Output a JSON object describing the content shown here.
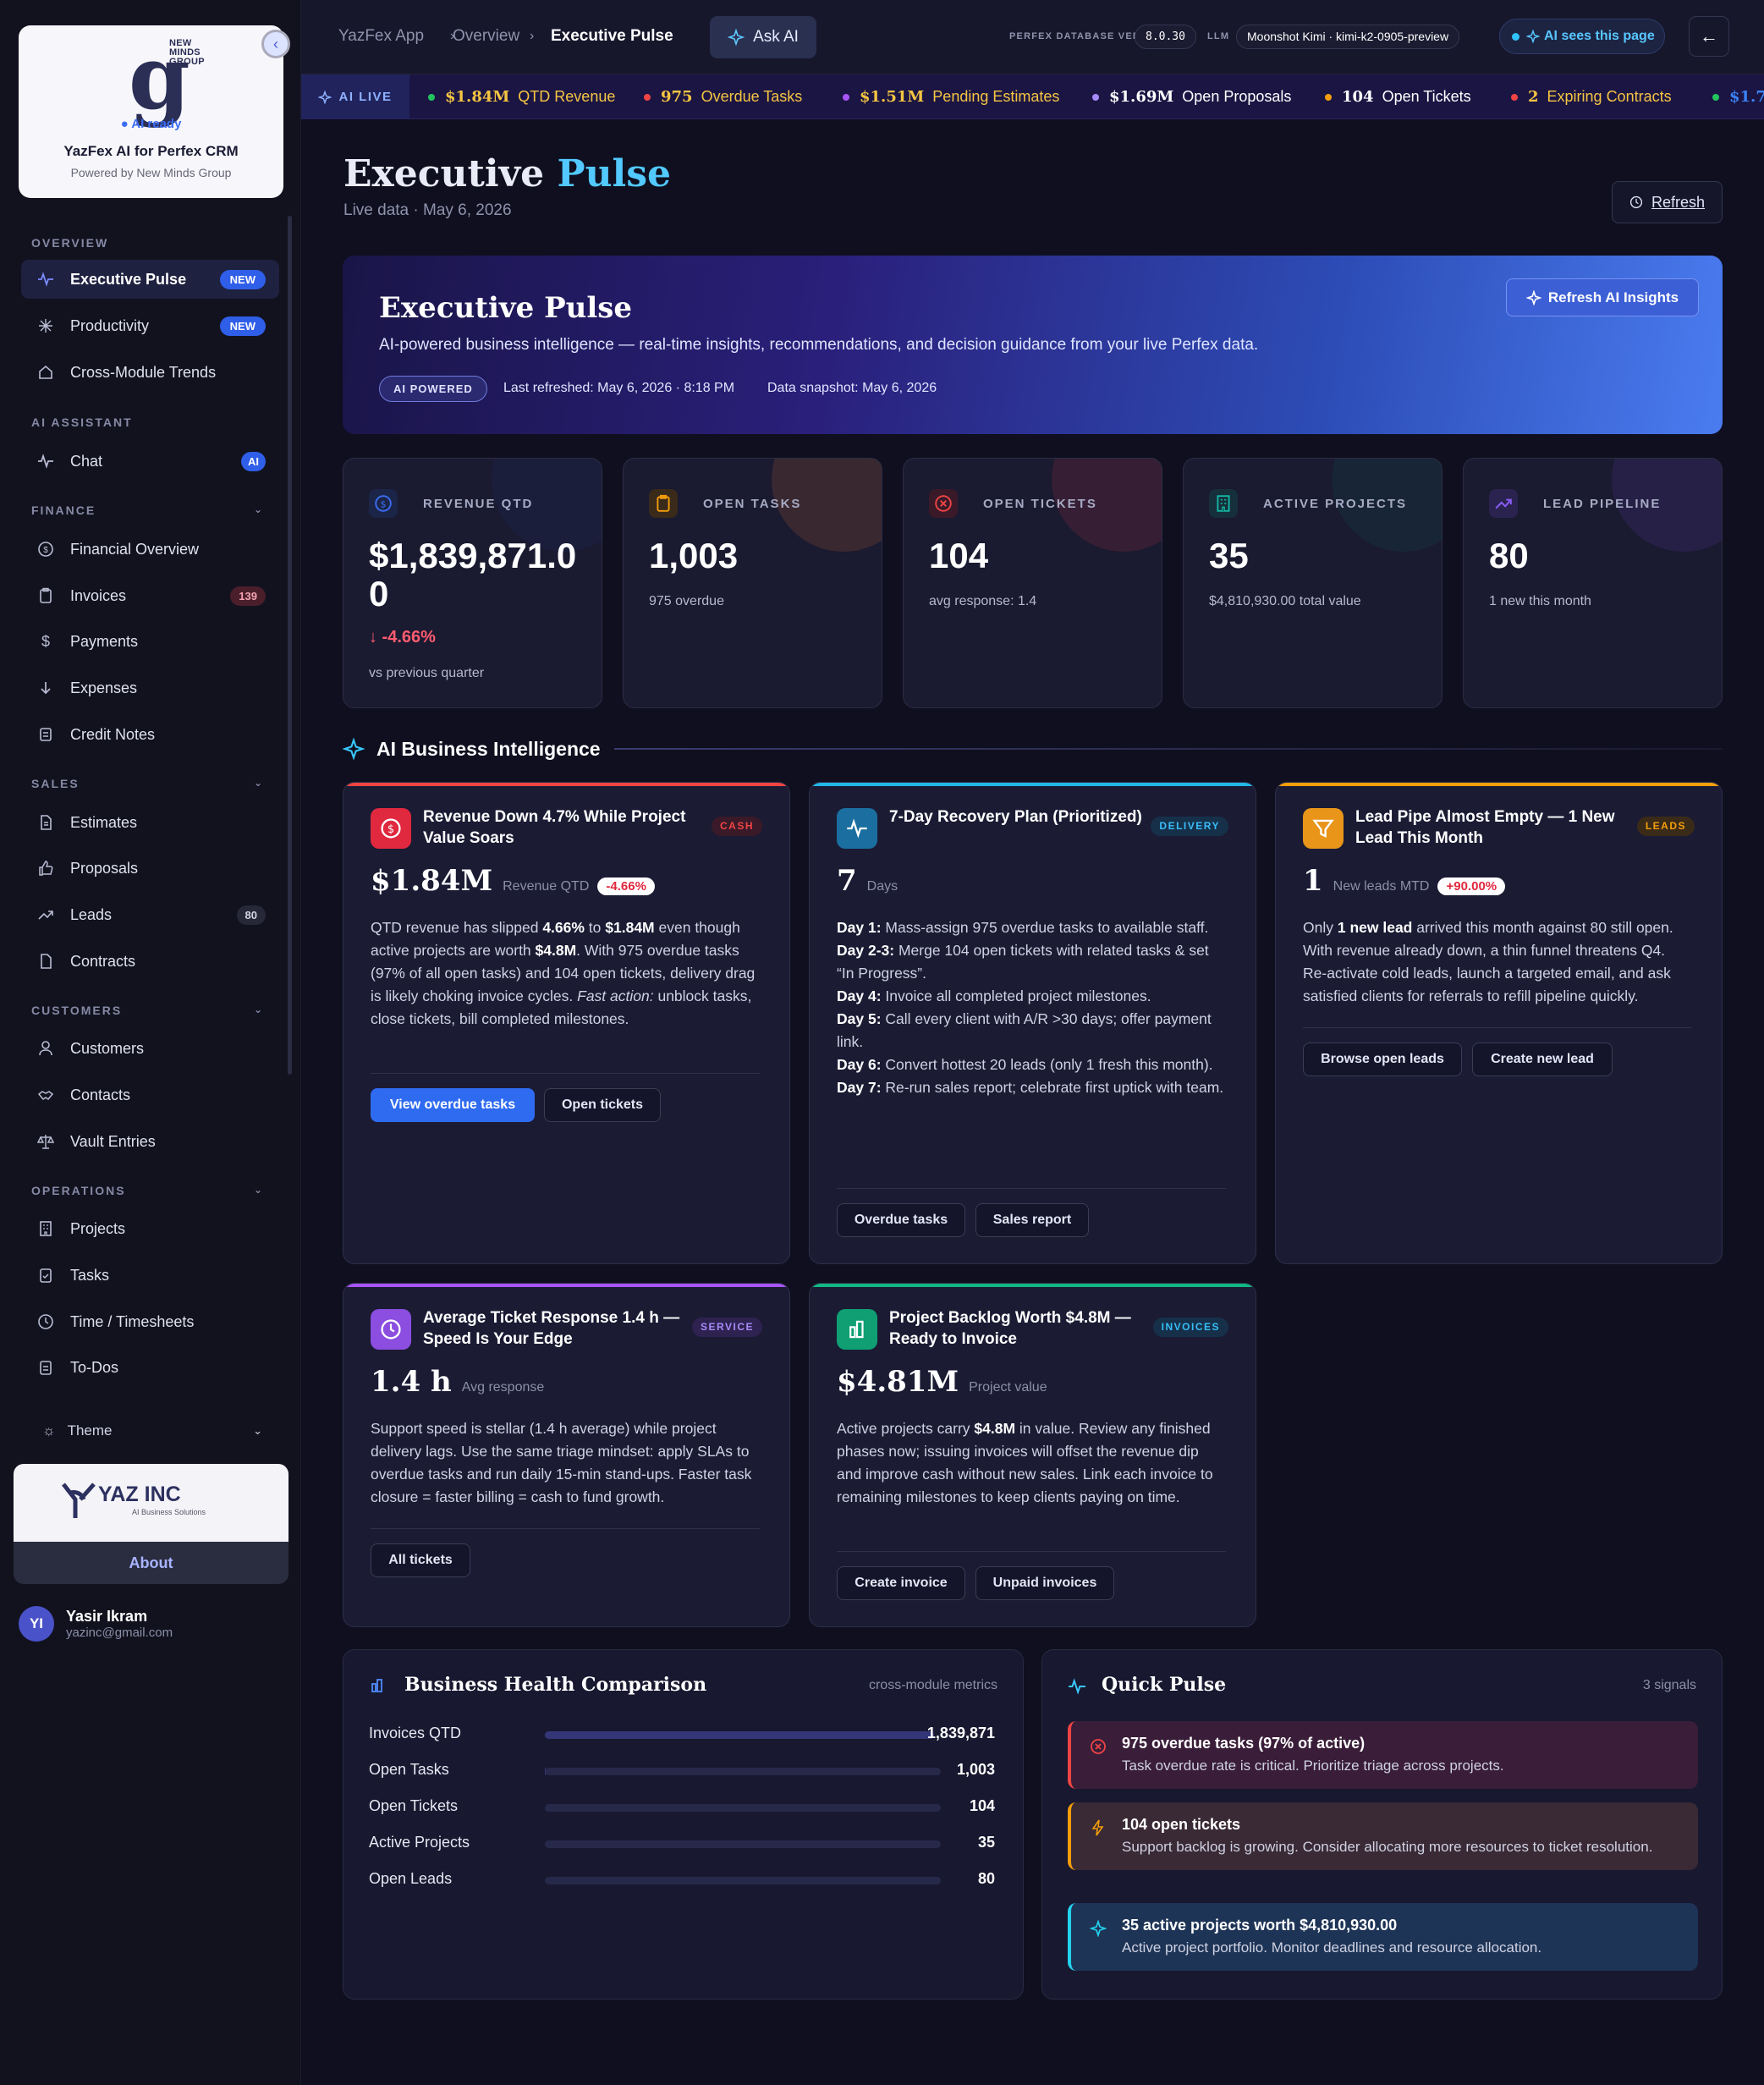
{
  "brand": {
    "logo_letter": "g",
    "logo_company": "NEW MINDS GROUP",
    "status": "AI ready",
    "title": "YazFex AI for Perfex CRM",
    "powered": "Powered by New Minds Group"
  },
  "sidebar": {
    "sections": {
      "overview": "OVERVIEW",
      "ai": "AI ASSISTANT",
      "finance": "FINANCE",
      "sales": "SALES",
      "customers": "CUSTOMERS",
      "operations": "OPERATIONS"
    },
    "items": {
      "executive_pulse": {
        "label": "Executive Pulse",
        "badge": "NEW"
      },
      "productivity": {
        "label": "Productivity",
        "badge": "NEW"
      },
      "cross_module": {
        "label": "Cross-Module Trends"
      },
      "chat": {
        "label": "Chat",
        "badge": "AI"
      },
      "financial_overview": {
        "label": "Financial Overview"
      },
      "invoices": {
        "label": "Invoices",
        "badge": "139"
      },
      "payments": {
        "label": "Payments"
      },
      "expenses": {
        "label": "Expenses"
      },
      "credit_notes": {
        "label": "Credit Notes"
      },
      "estimates": {
        "label": "Estimates"
      },
      "proposals": {
        "label": "Proposals"
      },
      "leads": {
        "label": "Leads",
        "badge": "80"
      },
      "contracts": {
        "label": "Contracts"
      },
      "customers": {
        "label": "Customers"
      },
      "contacts": {
        "label": "Contacts"
      },
      "vault": {
        "label": "Vault Entries"
      },
      "projects": {
        "label": "Projects"
      },
      "tasks": {
        "label": "Tasks"
      },
      "time": {
        "label": "Time / Timesheets"
      },
      "todos": {
        "label": "To-Dos"
      }
    },
    "theme_label": "Theme",
    "company": {
      "name": "YAZ INC",
      "tagline": "AI Business Solutions",
      "about": "About"
    },
    "user": {
      "initials": "YI",
      "name": "Yasir Ikram",
      "email": "yazinc@gmail.com"
    }
  },
  "topbar": {
    "crumbs": [
      "YazFex App",
      "Overview",
      "Executive Pulse"
    ],
    "ask_ai": "Ask AI",
    "db_label": "PERFEX DATABASE VER.",
    "db_version": "8.0.30",
    "llm_label": "LLM",
    "llm_model": "Moonshot Kimi · kimi-k2-0905-preview",
    "ai_sees": "AI sees this page",
    "back": "←"
  },
  "ticker": {
    "live_label": "AI LIVE",
    "items": [
      {
        "value": "$1.84M",
        "label": "QTD Revenue",
        "color": "#f5c542",
        "dot": "#22c55e"
      },
      {
        "value": "975",
        "label": "Overdue Tasks",
        "color": "#f5c542",
        "dot": "#ef4444"
      },
      {
        "value": "$1.51M",
        "label": "Pending Estimates",
        "color": "#f5c542",
        "dot": "#a855f7"
      },
      {
        "value": "$1.69M",
        "label": "Open Proposals",
        "color": "#ffffff",
        "dot": "#a78bfa"
      },
      {
        "value": "104",
        "label": "Open Tickets",
        "color": "#ffffff",
        "dot": "#f59e0b"
      },
      {
        "value": "2",
        "label": "Expiring Contracts",
        "color": "#f5c542",
        "dot": "#ef4444"
      },
      {
        "value": "$1.7",
        "label": "",
        "color": "#3b82f6",
        "dot": "#22c55e"
      }
    ]
  },
  "page": {
    "title_a": "Executive",
    "title_b": "Pulse",
    "subtitle": "Live data · May 6, 2026",
    "refresh": "Refresh"
  },
  "hero": {
    "title": "Executive Pulse",
    "description": "AI-powered business intelligence — real-time insights, recommendations, and decision guidance from your live Perfex data.",
    "tag": "AI POWERED",
    "last_refreshed": "Last refreshed: May 6, 2026 · 8:18 PM",
    "snapshot": "Data snapshot: May 6, 2026",
    "button": "Refresh AI Insights"
  },
  "kpis": [
    {
      "label": "REVENUE QTD",
      "value": "$1,839,871.00",
      "delta": "↓ -4.66%",
      "sub": "vs previous quarter",
      "color": "#3b6ef5"
    },
    {
      "label": "OPEN TASKS",
      "value": "1,003",
      "sub": "975 overdue",
      "color": "#f59e0b"
    },
    {
      "label": "OPEN TICKETS",
      "value": "104",
      "sub": "avg response: 1.4",
      "color": "#ef4444"
    },
    {
      "label": "ACTIVE PROJECTS",
      "value": "35",
      "sub": "$4,810,930.00 total value",
      "color": "#14b8a6"
    },
    {
      "label": "LEAD PIPELINE",
      "value": "80",
      "sub": "1 new this month",
      "color": "#8b5cf6"
    }
  ],
  "section_title": "AI Business Intelligence",
  "insights": {
    "revenue": {
      "title": "Revenue Down 4.7% While Project Value Soars",
      "tag": "CASH",
      "value": "$1.84M",
      "unit": "Revenue QTD",
      "change": "-4.66%",
      "p1": "QTD revenue has slipped ",
      "b1": "4.66%",
      "p2": " to ",
      "b2": "$1.84M",
      "p3": " even though active projects are worth ",
      "b3": "$4.8M",
      "p4": ". With 975 overdue tasks (97% of all open tasks) and 104 open tickets, delivery drag is likely choking invoice cycles. ",
      "i1": "Fast action:",
      "p5": " unblock tasks, close tickets, bill completed milestones.",
      "btn1": "View overdue tasks",
      "btn2": "Open tickets"
    },
    "recovery": {
      "title": "7-Day Recovery Plan (Prioritized)",
      "tag": "DELIVERY",
      "value": "7",
      "unit": "Days",
      "days": [
        {
          "d": "Day 1:",
          "t": " Mass-assign 975 overdue tasks to available staff."
        },
        {
          "d": "Day 2-3:",
          "t": " Merge 104 open tickets with related tasks & set “In Progress”."
        },
        {
          "d": "Day 4:",
          "t": " Invoice all completed project milestones."
        },
        {
          "d": "Day 5:",
          "t": " Call every client with A/R >30 days; offer payment link."
        },
        {
          "d": "Day 6:",
          "t": " Convert hottest 20 leads (only 1 fresh this month)."
        },
        {
          "d": "Day 7:",
          "t": " Re-run sales report; celebrate first uptick with team."
        }
      ],
      "btn1": "Overdue tasks",
      "btn2": "Sales report"
    },
    "leads": {
      "title": "Lead Pipe Almost Empty — 1 New Lead This Month",
      "tag": "LEADS",
      "value": "1",
      "unit": "New leads MTD",
      "change": "+90.00%",
      "p1": "Only ",
      "b1": "1 new lead",
      "p2": " arrived this month against 80 still open. With revenue already down, a thin funnel threatens Q4. Re-activate cold leads, launch a targeted email, and ask satisfied clients for referrals to refill pipeline quickly.",
      "btn1": "Browse open leads",
      "btn2": "Create new lead"
    },
    "tickets": {
      "title": "Average Ticket Response 1.4 h — Speed Is Your Edge",
      "tag": "SERVICE",
      "value": "1.4 h",
      "unit": "Avg response",
      "body": "Support speed is stellar (1.4 h average) while project delivery lags. Use the same triage mindset: apply SLAs to overdue tasks and run daily 15-min stand-ups. Faster task closure = faster billing = cash to fund growth.",
      "btn1": "All tickets"
    },
    "backlog": {
      "title": "Project Backlog Worth $4.8M — Ready to Invoice",
      "tag": "INVOICES",
      "value": "$4.81M",
      "unit": "Project value",
      "p1": "Active projects carry ",
      "b1": "$4.8M",
      "p2": " in value. Review any finished phases now; issuing invoices will offset the revenue dip and improve cash without new sales. Link each invoice to remaining milestones to keep clients paying on time.",
      "btn1": "Create invoice",
      "btn2": "Unpaid invoices"
    }
  },
  "health": {
    "title": "Business Health Comparison",
    "right": "cross-module metrics",
    "rows": [
      {
        "label": "Invoices QTD",
        "value": "1,839,871",
        "pct": 100
      },
      {
        "label": "Open Tasks",
        "value": "1,003",
        "pct": 0.05
      },
      {
        "label": "Open Tickets",
        "value": "104",
        "pct": 0.01
      },
      {
        "label": "Active Projects",
        "value": "35",
        "pct": 0
      },
      {
        "label": "Open Leads",
        "value": "80",
        "pct": 0
      }
    ]
  },
  "pulse": {
    "title": "Quick Pulse",
    "right": "3 signals",
    "signals": [
      {
        "title": "975 overdue tasks (97% of active)",
        "desc": "Task overdue rate is critical. Prioritize triage across projects.",
        "color": "#ef4444"
      },
      {
        "title": "104 open tickets",
        "desc": "Support backlog is growing. Consider allocating more resources to ticket resolution.",
        "color": "#f59e0b"
      },
      {
        "title": "35 active projects worth $4,810,930.00",
        "desc": "Active project portfolio. Monitor deadlines and resource allocation.",
        "color": "#22d3ee"
      }
    ]
  }
}
